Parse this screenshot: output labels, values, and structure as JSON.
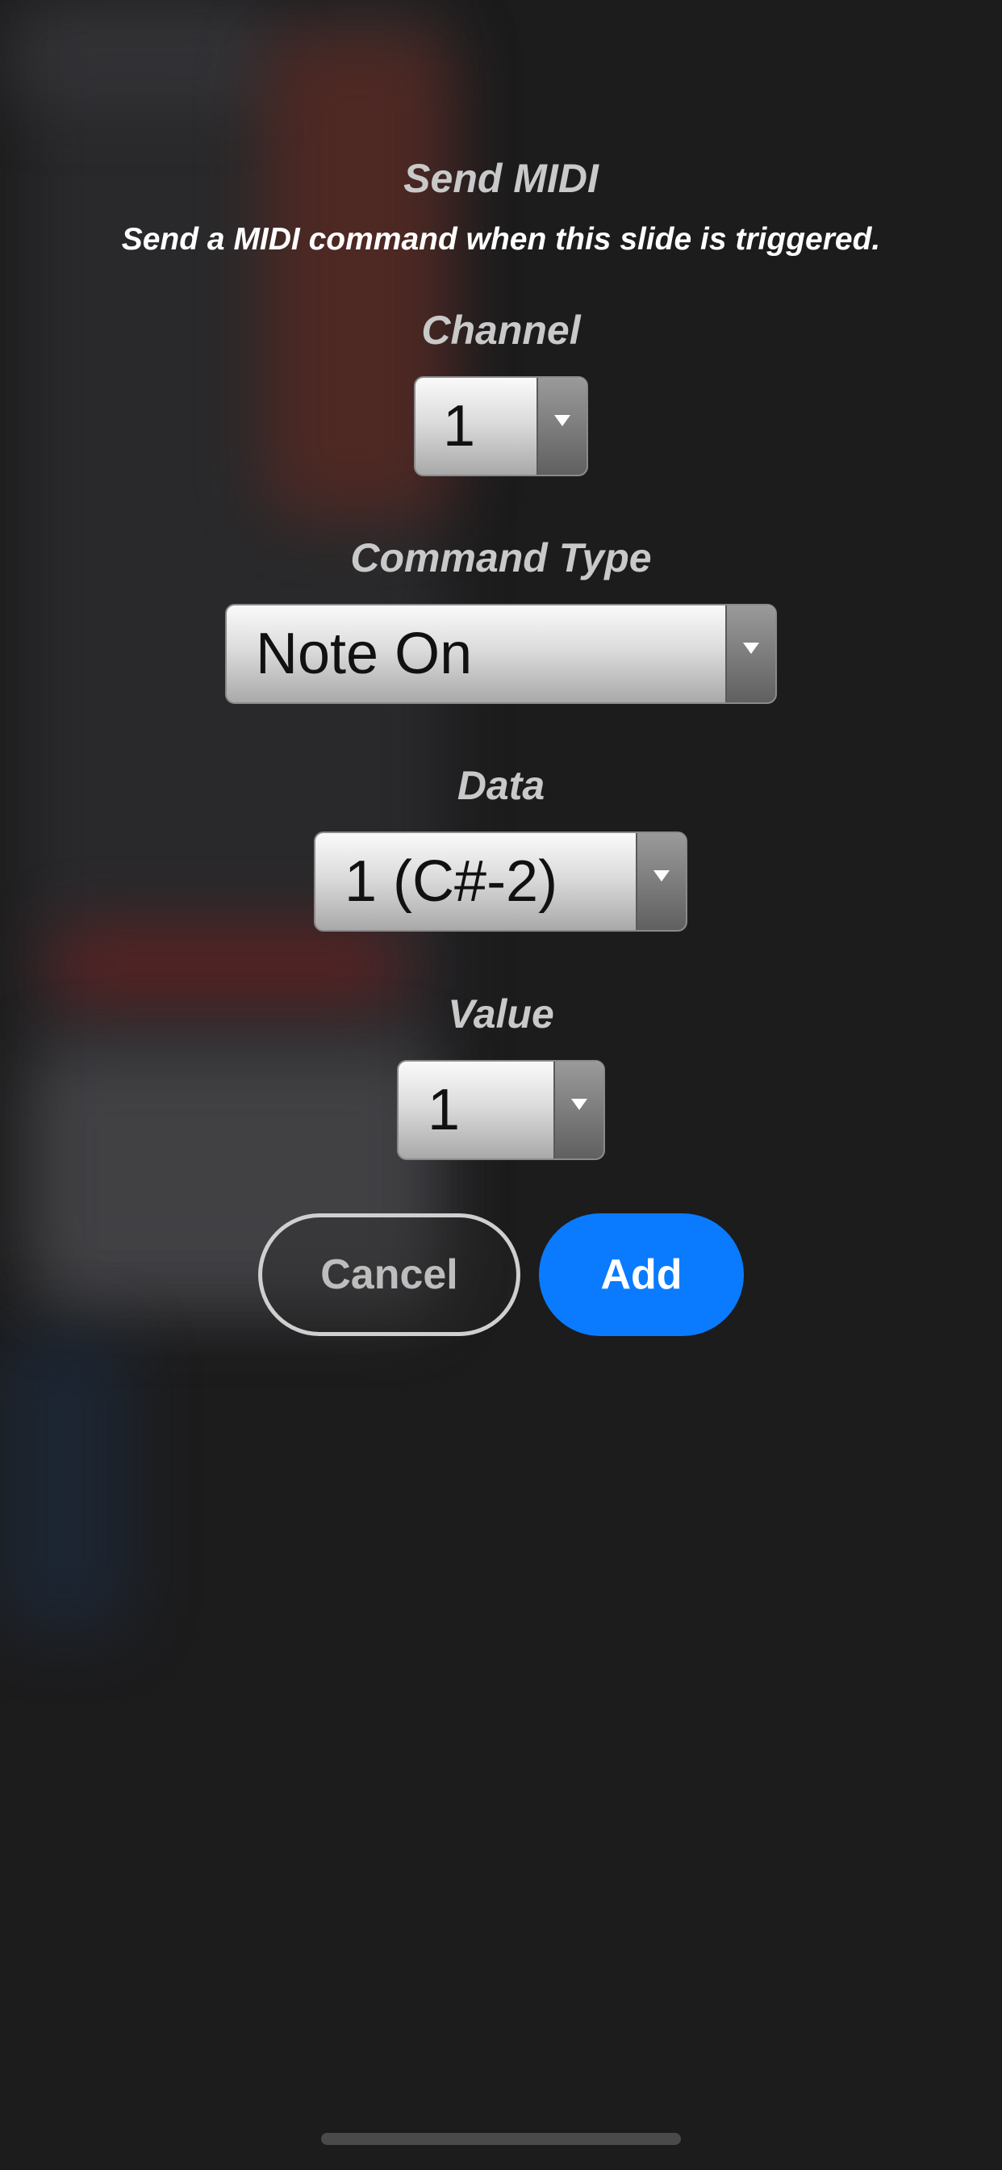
{
  "dialog": {
    "title": "Send MIDI",
    "subtitle": "Send a MIDI command when this slide is triggered."
  },
  "fields": {
    "channel": {
      "label": "Channel",
      "value": "1"
    },
    "command_type": {
      "label": "Command Type",
      "value": "Note On"
    },
    "data": {
      "label": "Data",
      "value": "1 (C#-2)"
    },
    "value": {
      "label": "Value",
      "value": "1"
    }
  },
  "buttons": {
    "cancel": "Cancel",
    "add": "Add"
  },
  "colors": {
    "accent": "#0a7bff",
    "background": "#1c1c1d"
  },
  "icons": {
    "dropdown": "chevron-down-icon"
  }
}
